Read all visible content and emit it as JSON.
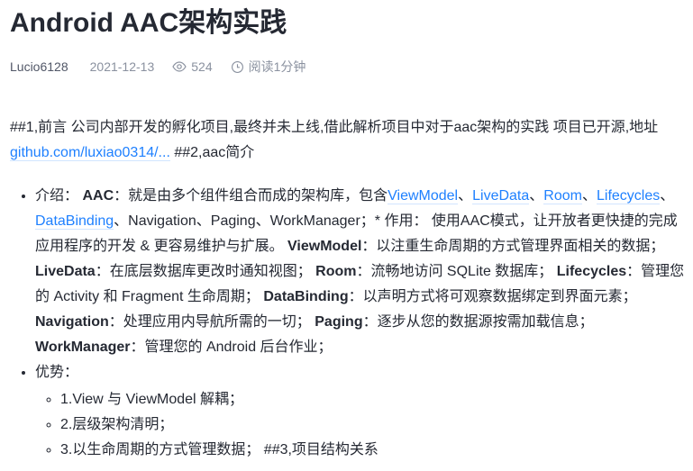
{
  "title": "Android AAC架构实践",
  "meta": {
    "author": "Lucio6128",
    "date": "2021-12-13",
    "views": "524",
    "read_time": "阅读1分钟"
  },
  "intro": {
    "text1": "##1,前言 公司内部开发的孵化项目,最终并未上线,借此解析项目中对于aac架构的实践 项目已开源,地址 ",
    "link": "github.com/luxiao0314/...",
    "text2": " ##2,aac简介"
  },
  "list": [
    {
      "segments": [
        {
          "t": "text",
          "v": "介绍： "
        },
        {
          "t": "bold",
          "v": "AAC"
        },
        {
          "t": "text",
          "v": "：就是由多个组件组合而成的架构库，包含"
        },
        {
          "t": "link",
          "v": "ViewModel"
        },
        {
          "t": "text",
          "v": "、"
        },
        {
          "t": "link",
          "v": "LiveData"
        },
        {
          "t": "text",
          "v": "、"
        },
        {
          "t": "link",
          "v": "Room"
        },
        {
          "t": "text",
          "v": "、"
        },
        {
          "t": "link",
          "v": "Lifecycles"
        },
        {
          "t": "text",
          "v": "、"
        },
        {
          "t": "link",
          "v": "DataBinding"
        },
        {
          "t": "text",
          "v": "、Navigation、Paging、WorkManager；* 作用： 使用AAC模式，让开放者更快捷的完成应用程序的开发 & 更容易维护与扩展。 "
        },
        {
          "t": "bold",
          "v": "ViewModel"
        },
        {
          "t": "text",
          "v": "：以注重生命周期的方式管理界面相关的数据； "
        },
        {
          "t": "bold",
          "v": "LiveData"
        },
        {
          "t": "text",
          "v": "：在底层数据库更改时通知视图； "
        },
        {
          "t": "bold",
          "v": "Room"
        },
        {
          "t": "text",
          "v": "：流畅地访问 SQLite 数据库； "
        },
        {
          "t": "bold",
          "v": "Lifecycles"
        },
        {
          "t": "text",
          "v": "：管理您的 Activity 和 Fragment 生命周期； "
        },
        {
          "t": "bold",
          "v": "DataBinding"
        },
        {
          "t": "text",
          "v": "：以声明方式将可观察数据绑定到界面元素； "
        },
        {
          "t": "bold",
          "v": "Navigation"
        },
        {
          "t": "text",
          "v": "：处理应用内导航所需的一切； "
        },
        {
          "t": "bold",
          "v": "Paging"
        },
        {
          "t": "text",
          "v": "：逐步从您的数据源按需加载信息； "
        },
        {
          "t": "bold",
          "v": "WorkManager"
        },
        {
          "t": "text",
          "v": "：管理您的 Android 后台作业；"
        }
      ]
    },
    {
      "segments": [
        {
          "t": "text",
          "v": "优势："
        }
      ],
      "children": [
        "1.View 与 ViewModel 解耦；",
        "2.层级架构清明；",
        "3.以生命周期的方式管理数据； ##3,项目结构关系"
      ]
    }
  ]
}
